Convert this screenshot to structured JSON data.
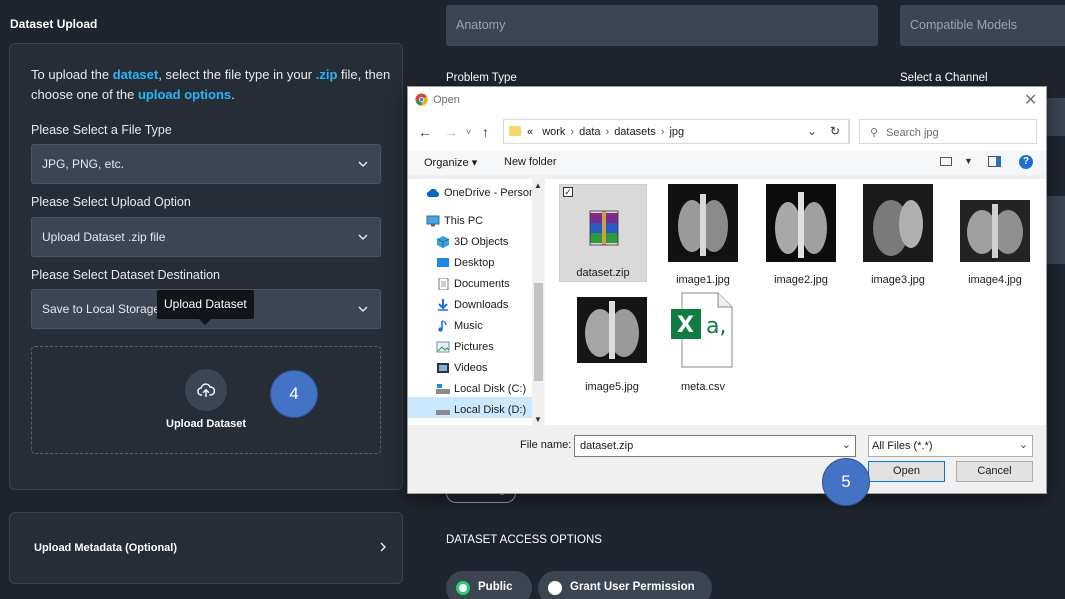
{
  "left": {
    "title": "Dataset Upload",
    "intro": {
      "part1": "To upload the ",
      "hl1": "dataset",
      "part2": ", select the file type in your ",
      "hl2": ".zip",
      "part3": " file, then choose one of the ",
      "hl3": "upload options",
      "part4": "."
    },
    "file_type_label": "Please Select a File Type",
    "file_type_value": "JPG, PNG, etc.",
    "upload_option_label": "Please Select Upload Option",
    "upload_option_value": "Upload Dataset .zip file",
    "destination_label": "Please Select Dataset Destination",
    "destination_value": "Save to Local Storage",
    "tooltip": "Upload Dataset",
    "upload_button_label": "Upload Dataset",
    "metadata_label": "Upload Metadata (Optional)"
  },
  "badges": {
    "step4": "4",
    "step5": "5"
  },
  "right": {
    "anatomy_placeholder": "Anatomy",
    "models_placeholder": "Compatible Models",
    "problem_type_label": "Problem Type",
    "channel_label": "Select a Channel",
    "add_tag_label": "+ New Tag",
    "access_title": "DATASET ACCESS OPTIONS",
    "public_label": "Public",
    "grant_label": "Grant User Permission"
  },
  "dialog": {
    "title": "Open",
    "path": [
      "work",
      "data",
      "datasets",
      "jpg"
    ],
    "path_prefix": "«",
    "search_placeholder": "Search jpg",
    "organize_label": "Organize ▾",
    "new_folder_label": "New folder",
    "sidebar": [
      {
        "label": "OneDrive - Person",
        "icon": "cloud-icon"
      },
      {
        "label": "This PC",
        "icon": "computer-icon"
      },
      {
        "label": "3D Objects",
        "icon": "cube-icon"
      },
      {
        "label": "Desktop",
        "icon": "desktop-icon"
      },
      {
        "label": "Documents",
        "icon": "document-icon"
      },
      {
        "label": "Downloads",
        "icon": "download-icon"
      },
      {
        "label": "Music",
        "icon": "music-icon"
      },
      {
        "label": "Pictures",
        "icon": "pictures-icon"
      },
      {
        "label": "Videos",
        "icon": "video-icon"
      },
      {
        "label": "Local Disk (C:)",
        "icon": "disk-icon"
      },
      {
        "label": "Local Disk (D:)",
        "icon": "disk-icon"
      }
    ],
    "files": [
      {
        "name": "dataset.zip",
        "kind": "zip"
      },
      {
        "name": "image1.jpg",
        "kind": "xray"
      },
      {
        "name": "image2.jpg",
        "kind": "xray"
      },
      {
        "name": "image3.jpg",
        "kind": "xray"
      },
      {
        "name": "image4.jpg",
        "kind": "xray"
      },
      {
        "name": "image5.jpg",
        "kind": "xray"
      },
      {
        "name": "meta.csv",
        "kind": "csv"
      }
    ],
    "file_name_label": "File name:",
    "file_name_value": "dataset.zip",
    "file_type_value": "All Files (*.*)",
    "open_label": "Open",
    "cancel_label": "Cancel"
  },
  "colors": {
    "panel": "#1f252e",
    "card": "#262d37",
    "field": "#3c4552",
    "accent": "#29b6f6",
    "badge": "#4472c4",
    "selection": "#cce8ff"
  }
}
